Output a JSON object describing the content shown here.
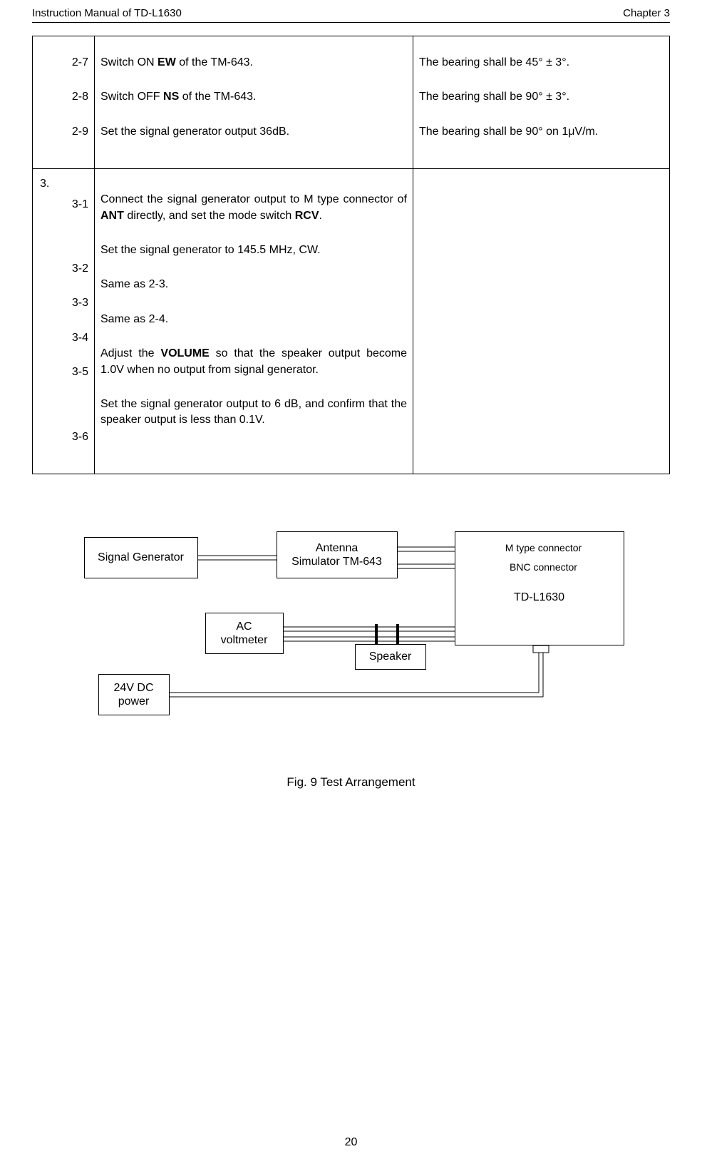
{
  "header": {
    "left": "Instruction Manual of TD-L1630",
    "right": "Chapter 3"
  },
  "table": {
    "row2": {
      "s27": {
        "num": "2-7",
        "text_a": "Switch ON ",
        "bold": "EW",
        "text_b": " of the TM-643.",
        "judge": "The bearing shall be 45° ± 3°."
      },
      "s28": {
        "num": "2-8",
        "text_a": "Switch OFF ",
        "bold": "NS",
        "text_b": " of the TM-643.",
        "judge": "The bearing shall be 90° ± 3°."
      },
      "s29": {
        "num": "2-9",
        "text": "Set the signal generator output 36dB.",
        "judge": "The bearing shall be 90° on 1μV/m."
      }
    },
    "row3": {
      "head": "3.",
      "s31": {
        "num": "3-1",
        "text_a": "Connect the signal generator output to M type connector of ",
        "bold": "ANT",
        "text_b": " directly, and set the mode switch ",
        "bold2": "RCV",
        "text_c": "."
      },
      "s32": {
        "num": "3-2",
        "text": "Set the signal generator to 145.5 MHz, CW."
      },
      "s33": {
        "num": "3-3",
        "text": "Same as 2-3."
      },
      "s34": {
        "num": "3-4",
        "text": "Same as 2-4."
      },
      "s35": {
        "num": "3-5",
        "text_a": "Adjust the ",
        "bold": "VOLUME",
        "text_b": " so that the speaker output become 1.0V when no output from signal generator."
      },
      "s36": {
        "num": "3-6",
        "text": "Set the signal generator output to 6 dB, and confirm that the speaker output is less than 0.1V."
      }
    }
  },
  "diagram": {
    "sig_gen": "Signal Generator",
    "antenna_l1": "Antenna",
    "antenna_l2": "Simulator TM-643",
    "td": "TD-L1630",
    "m_conn": "M type connector",
    "bnc_conn": "BNC connector",
    "ac_l1": "AC",
    "ac_l2": "voltmeter",
    "speaker": "Speaker",
    "pwr_l1": "24V DC",
    "pwr_l2": "power"
  },
  "fig_caption": "Fig. 9   Test Arrangement",
  "page_number": "20"
}
